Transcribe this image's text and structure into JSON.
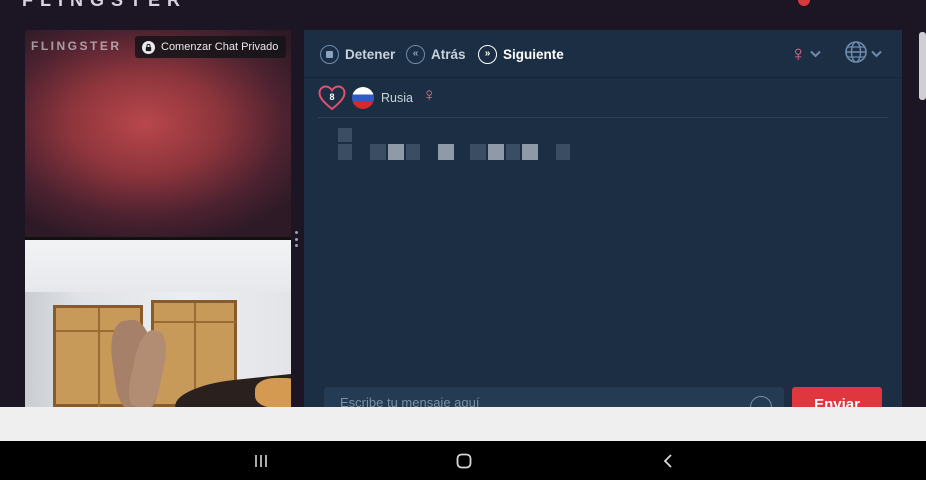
{
  "top": {
    "logo_text": "FLINGSTER"
  },
  "video": {
    "watermark": "FLINGSTER",
    "private_chat_label": "Comenzar Chat Privado"
  },
  "toolbar": {
    "stop_label": "Detener",
    "back_label": "Atrás",
    "next_label": "Siguiente",
    "gender_filter_icon": "venus-icon",
    "language_filter_icon": "globe-icon"
  },
  "partner": {
    "likes_count": "8",
    "country": "Rusia",
    "gender_symbol": "♀"
  },
  "composer": {
    "placeholder": "Escribe tu mensaje aquí",
    "send_label": "Enviar"
  },
  "colors": {
    "panel": "#1b2e43",
    "accent_pink": "#e36f8f",
    "send_red": "#e0373f"
  }
}
